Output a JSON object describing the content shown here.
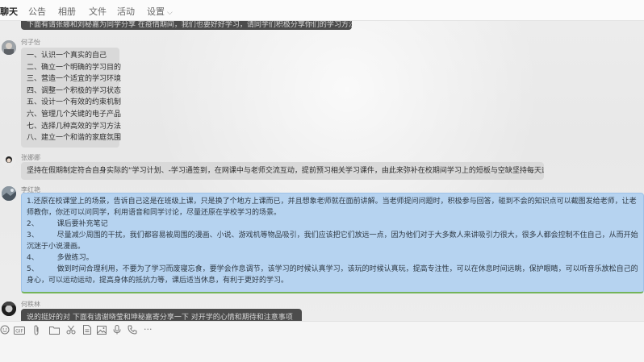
{
  "tabs": [
    {
      "label": "聊天"
    },
    {
      "label": "公告"
    },
    {
      "label": "相册"
    },
    {
      "label": "文件"
    },
    {
      "label": "活动"
    },
    {
      "label": "设置"
    }
  ],
  "messages": {
    "m0": {
      "text": "下面有请张娜和刘秘嘉为同学分享 在疫情期间，我们也要好好学习，请同学们积极分享你们的学习方法"
    },
    "m1": {
      "sender": "何子怡",
      "lines": [
        "一、认识一个真实的自己",
        "二、确立一个明确的学习目的",
        "三、营造一个适宜的学习环境",
        "四、调整一个积极的学习状态",
        "五、设计一个有效的约束机制",
        "六、管理几个关键的电子产品",
        "七、选择几种高效的学习方法",
        "八、建立一个和谐的家庭氛围"
      ]
    },
    "m2": {
      "sender": "张娜娜",
      "text": "坚持在假期制定符合自身实际的“学习计划、-学习通签到，在网课中与老师交流互动，提前预习相关学习课件，由此来弥补在校期间学习上的短板与空缺坚持每天运动···"
    },
    "m3": {
      "sender": "李红艳",
      "p1": "1.还原在校课堂上的场景，告诉自己这是在班级上课，只是换了个地方上课而已，并且想象老师就在面前讲解。当老师提问问题时，积极参与回答，碰到不会的知识点可以截图发给老师，让老师教你，你还可以问同学，利用语音和同学讨论，尽量还原在学校学习的场景。",
      "p2": "2、        课后要补充笔记",
      "p3": "3、        尽量减少周围的干扰，我们都容易被周围的漫画、小说、游戏机等物品吸引，我们应该把它们放远一点，因为他们对于大多数人来讲吸引力很大，很多人都会控制不住自己，从而开始沉迷于小说漫画。",
      "p4": "4、        多做练习。",
      "p5": "5、        做到时间合理利用，不要为了学习而废寝忘食，要学会作息调节，该学习的时候认真学习，该玩的时候认真玩，提高专注性，可以在休息时间远眺，保护眼睛，可以听音乐放松自己的身心，可以运动运动，提高身体的抵抗力等，课后适当休息，有利于更好的学习。"
    },
    "m4": {
      "sender": "何秩林",
      "text": "说的挺好的对 下面有请谢晓莹和坤秘嘉寄分享一下 对开学的心情和期待和注意事项"
    }
  },
  "toolbar": {
    "icons": [
      "emoji-icon",
      "gif-icon",
      "paperclip-icon",
      "folder-icon",
      "scissors-icon",
      "doc-icon",
      "image-icon",
      "voice-icon",
      "phone-icon",
      "more-icon"
    ]
  }
}
